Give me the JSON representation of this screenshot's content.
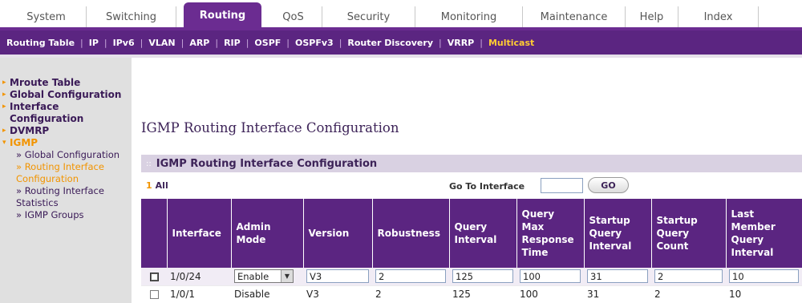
{
  "top_tabs": [
    {
      "label": "System"
    },
    {
      "label": "Switching"
    },
    {
      "label": "Routing",
      "active": true
    },
    {
      "label": "QoS"
    },
    {
      "label": "Security"
    },
    {
      "label": "Monitoring"
    },
    {
      "label": "Maintenance"
    },
    {
      "label": "Help"
    },
    {
      "label": "Index"
    }
  ],
  "subnav": {
    "items": [
      "Routing Table",
      "IP",
      "IPv6",
      "VLAN",
      "ARP",
      "RIP",
      "OSPF",
      "OSPFv3",
      "Router Discovery",
      "VRRP",
      "Multicast"
    ],
    "separator": "|",
    "current": "Multicast"
  },
  "sidebar": {
    "items": [
      {
        "label": "Mroute Table"
      },
      {
        "label": "Global Configuration"
      },
      {
        "label": "Interface Configuration"
      },
      {
        "label": "DVMRP"
      },
      {
        "label": "IGMP",
        "active": true
      }
    ],
    "sub_items": [
      {
        "label": "» Global Configuration"
      },
      {
        "label": "» Routing Interface Configuration",
        "current": true
      },
      {
        "label": "» Routing Interface Statistics"
      },
      {
        "label": "» IGMP Groups"
      }
    ]
  },
  "page_title": "IGMP Routing Interface Configuration",
  "panel": {
    "title": "IGMP Routing Interface Configuration",
    "dots": "::"
  },
  "toolbar": {
    "count_num": "1",
    "count_label": "All",
    "goto_label": "Go To Interface",
    "goto_value": "",
    "go_label": "GO"
  },
  "table": {
    "headers": [
      "Interface",
      "Admin Mode",
      "Version",
      "Robustness",
      "Query Interval",
      "Query Max Response Time",
      "Startup Query Interval",
      "Startup Query Count",
      "Last Member Query Interval"
    ],
    "edit_row": {
      "interface": "1/0/24",
      "admin_mode": "Enable",
      "version": "V3",
      "robustness": "2",
      "query_interval": "125",
      "query_max_response_time": "100",
      "startup_query_interval": "31",
      "startup_query_count": "2",
      "last_member_query_interval": "10"
    },
    "rows": [
      {
        "interface": "1/0/1",
        "admin_mode": "Disable",
        "version": "V3",
        "robustness": "2",
        "query_interval": "125",
        "query_max_response_time": "100",
        "startup_query_interval": "31",
        "startup_query_count": "2",
        "last_member_query_interval": "10"
      }
    ]
  },
  "colors": {
    "brand_purple": "#5b2581",
    "accent_orange": "#f29400"
  }
}
